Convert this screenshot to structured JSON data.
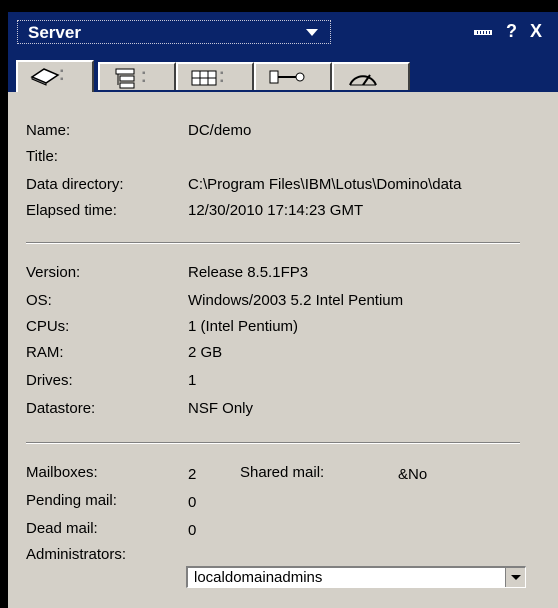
{
  "header": {
    "title": "Server",
    "help_icon": "?",
    "close_icon": "X"
  },
  "tabs": [
    {
      "icon": "server-info-icon",
      "active": true
    },
    {
      "icon": "tree-icon",
      "active": false
    },
    {
      "icon": "grid-icon",
      "active": false
    },
    {
      "icon": "network-icon",
      "active": false
    },
    {
      "icon": "gauge-icon",
      "active": false
    }
  ],
  "info": {
    "name_label": "Name:",
    "name_value": "DC/demo",
    "title_label": "Title:",
    "datadir_label": "Data directory:",
    "datadir_value": "C:\\Program Files\\IBM\\Lotus\\Domino\\data",
    "elapsed_label": "Elapsed time:",
    "elapsed_value": "12/30/2010 17:14:23 GMT"
  },
  "system": {
    "version_label": "Version:",
    "version_value": "Release 8.5.1FP3",
    "os_label": "OS:",
    "os_value": "Windows/2003 5.2 Intel Pentium",
    "cpus_label": "CPUs:",
    "cpus_value": "1 (Intel Pentium)",
    "ram_label": "RAM:",
    "ram_value": "2 GB",
    "drives_label": "Drives:",
    "drives_value": "1",
    "datastore_label": "Datastore:",
    "datastore_value": "NSF Only"
  },
  "mail": {
    "mailboxes_label": "Mailboxes:",
    "mailboxes_value": "2",
    "shared_label": "Shared mail:",
    "shared_value": "&No",
    "pending_label": "Pending mail:",
    "pending_value": "0",
    "dead_label": "Dead mail:",
    "dead_value": "0",
    "admins_label": "Administrators:",
    "admins_value": "localdomainadmins"
  }
}
